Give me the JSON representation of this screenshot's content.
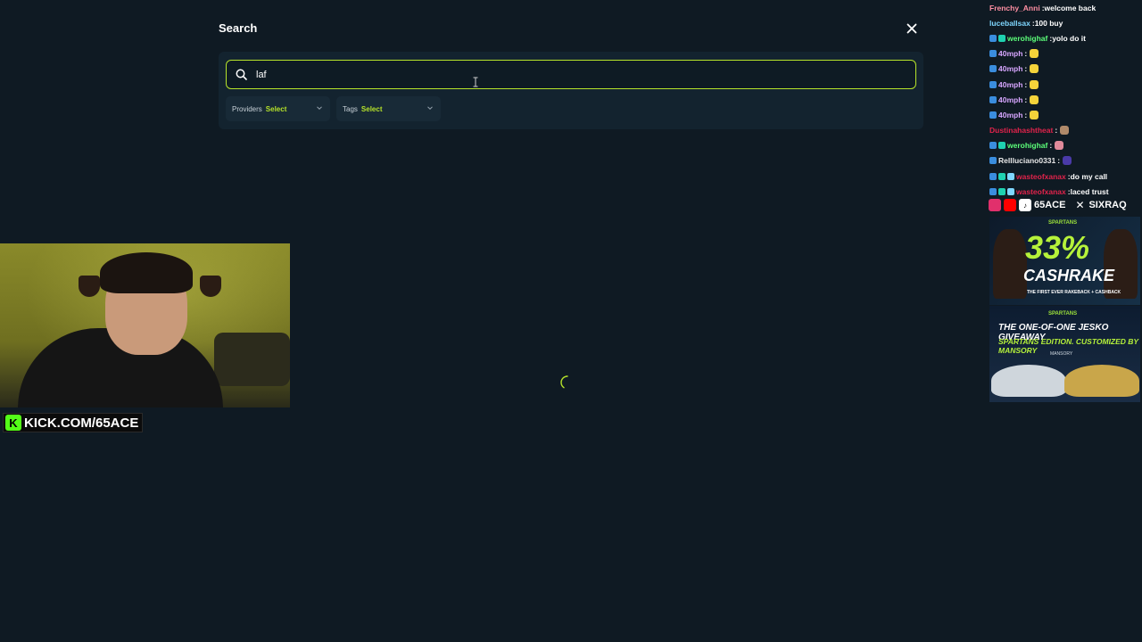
{
  "search": {
    "title": "Search",
    "query": "laf",
    "filters": [
      {
        "label": "Providers",
        "value": "Select"
      },
      {
        "label": "Tags",
        "value": "Select"
      }
    ]
  },
  "colors": {
    "accent": "#b6e32a",
    "background": "#0f1a23",
    "panel": "#13232f"
  },
  "stream_overlay": {
    "channel_tag": "KICK.COM/65ACE",
    "socials": [
      "65ACE",
      "SIXRAQ"
    ]
  },
  "chat": [
    {
      "user": "Frenchy_Anni",
      "color": "#ff8fa3",
      "badges": 0,
      "message": "welcome back",
      "emote": null
    },
    {
      "user": "luceballsax",
      "color": "#7fd7ff",
      "badges": 0,
      "message": "100 buy",
      "emote": null
    },
    {
      "user": "werohighaf",
      "color": "#5cff7a",
      "badges": 2,
      "message": "yolo do it",
      "emote": null
    },
    {
      "user": "40mph",
      "color": "#d7a6ff",
      "badges": 1,
      "message": "",
      "emote": "#f5d33a"
    },
    {
      "user": "40mph",
      "color": "#d7a6ff",
      "badges": 1,
      "message": "",
      "emote": "#f5d33a"
    },
    {
      "user": "40mph",
      "color": "#d7a6ff",
      "badges": 1,
      "message": "",
      "emote": "#f5d33a"
    },
    {
      "user": "40mph",
      "color": "#d7a6ff",
      "badges": 1,
      "message": "",
      "emote": "#f5d33a"
    },
    {
      "user": "40mph",
      "color": "#d7a6ff",
      "badges": 1,
      "message": "",
      "emote": "#f5d33a"
    },
    {
      "user": "Dustinahashtheat",
      "color": "#e0234b",
      "badges": 0,
      "message": "",
      "emote": "#b08a6a"
    },
    {
      "user": "werohighaf",
      "color": "#5cff7a",
      "badges": 2,
      "message": "",
      "emote": "#e08a9a"
    },
    {
      "user": "Rellluciano0331",
      "color": "#e8e8e8",
      "badges": 1,
      "message": "",
      "emote": "#4a3aa8"
    },
    {
      "user": "wasteofxanax",
      "color": "#e0234b",
      "badges": 3,
      "message": "do my call",
      "emote": null
    },
    {
      "user": "wasteofxanax",
      "color": "#e0234b",
      "badges": 3,
      "message": "laced trust",
      "emote": null
    }
  ],
  "ads": {
    "ad1": {
      "brand": "SPARTANS",
      "headline": "33%",
      "main": "CASHRAKE",
      "sub": "THE FIRST EVER RAKEBACK + CASHBACK"
    },
    "ad2": {
      "brand": "SPARTANS",
      "line1": "THE ONE-OF-ONE JESKO GIVEAWAY",
      "line2": "SPARTANS EDITION. CUSTOMIZED BY MANSORY",
      "maker": "MANSORY"
    }
  }
}
